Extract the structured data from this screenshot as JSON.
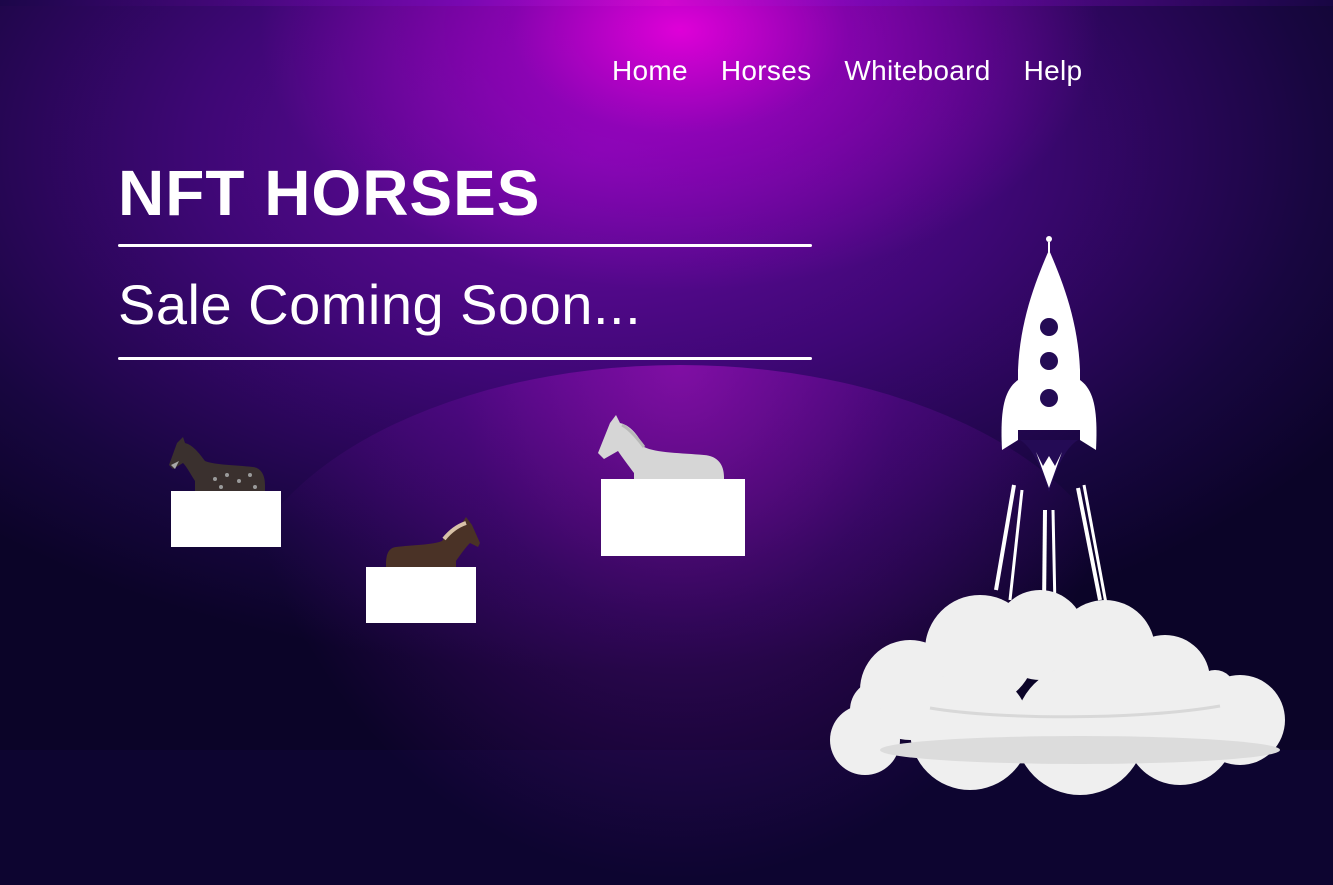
{
  "nav": {
    "items": [
      "Home",
      "Horses",
      "Whiteboard",
      "Help"
    ]
  },
  "hero": {
    "title": "NFT HORSES",
    "subtitle": "Sale Coming Soon..."
  },
  "horses": [
    {
      "name": "dapple-grey-horse",
      "color": "#3a302e"
    },
    {
      "name": "brown-horse",
      "color": "#4a3226"
    },
    {
      "name": "white-horse",
      "color": "#d6d6d6"
    }
  ],
  "colors": {
    "accent_magenta": "#e000d8",
    "accent_purple": "#6d0aa6",
    "background_dark": "#0d0530",
    "text": "#ffffff"
  },
  "icons": [
    "rocket-icon",
    "smoke-cloud-icon"
  ]
}
